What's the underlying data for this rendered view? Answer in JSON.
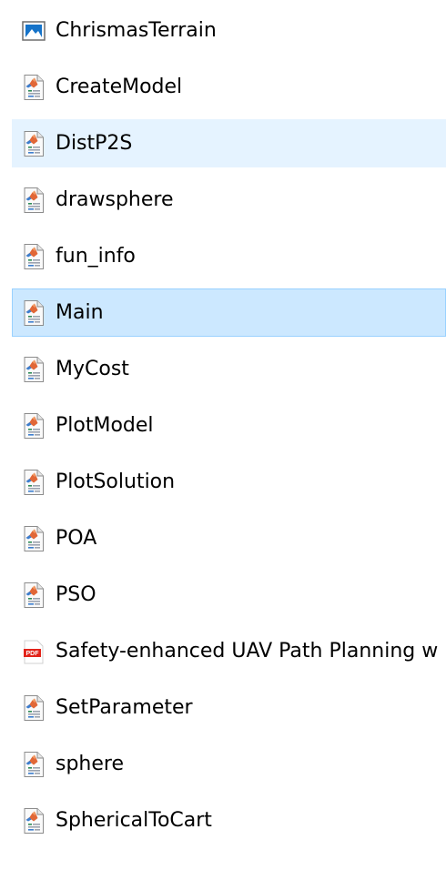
{
  "files": [
    {
      "name": "ChrismasTerrain",
      "icon": "image-file-icon",
      "state": "normal"
    },
    {
      "name": "CreateModel",
      "icon": "matlab-file-icon",
      "state": "normal"
    },
    {
      "name": "DistP2S",
      "icon": "matlab-file-icon",
      "state": "hover"
    },
    {
      "name": "drawsphere",
      "icon": "matlab-file-icon",
      "state": "normal"
    },
    {
      "name": "fun_info",
      "icon": "matlab-file-icon",
      "state": "normal"
    },
    {
      "name": "Main",
      "icon": "matlab-file-icon",
      "state": "selected"
    },
    {
      "name": "MyCost",
      "icon": "matlab-file-icon",
      "state": "normal"
    },
    {
      "name": "PlotModel",
      "icon": "matlab-file-icon",
      "state": "normal"
    },
    {
      "name": "PlotSolution",
      "icon": "matlab-file-icon",
      "state": "normal"
    },
    {
      "name": "POA",
      "icon": "matlab-file-icon",
      "state": "normal"
    },
    {
      "name": "PSO",
      "icon": "matlab-file-icon",
      "state": "normal"
    },
    {
      "name": "Safety-enhanced UAV Path Planning w",
      "icon": "pdf-file-icon",
      "icon_label": "PDF",
      "state": "normal"
    },
    {
      "name": "SetParameter",
      "icon": "matlab-file-icon",
      "state": "normal"
    },
    {
      "name": "sphere",
      "icon": "matlab-file-icon",
      "state": "normal"
    },
    {
      "name": "SphericalToCart",
      "icon": "matlab-file-icon",
      "state": "normal"
    }
  ],
  "colors": {
    "hover_bg": "#e5f3ff",
    "selected_bg": "#cce8ff",
    "selected_border": "#99d1ff",
    "pdf_red": "#e2231a",
    "matlab_orange": "#e16737"
  }
}
